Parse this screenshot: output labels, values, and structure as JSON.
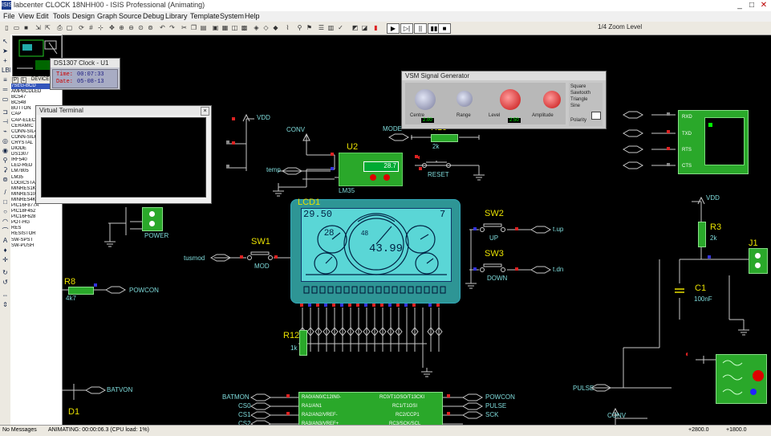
{
  "window": {
    "title": "labcenter CLOCK 18NHH00 - ISIS Professional (Animating)",
    "minimize": "_",
    "maximize": "□",
    "close": "✕"
  },
  "menu": [
    "File",
    "View",
    "Edit",
    "Tools",
    "Design",
    "Graph",
    "Source",
    "Debug",
    "Library",
    "Template",
    "System",
    "Help"
  ],
  "toolbar": {
    "zoom_text": "1/4 Zoom Level"
  },
  "devices": {
    "tabs": [
      "P",
      "L",
      "DEVICES"
    ],
    "items": [
      "7SEG-BCD",
      "AMPBCDLED",
      "BC547",
      "BC548",
      "BUTTON",
      "CAP",
      "CAP-ELEC",
      "CERAMIC",
      "CONN-SIL4",
      "CONN-SIL6",
      "CRYSTAL",
      "DIODE",
      "DS1307",
      "IRF540",
      "LED-RED",
      "LM7805",
      "LM35",
      "LOGICSTATE",
      "MINRES1K",
      "MINRES10K",
      "MINRES4K7",
      "PIC16F877A",
      "PIC18F452",
      "PIC16F628",
      "POT-HG",
      "RES",
      "RESISTOR",
      "SW-SPST",
      "SW-PUSH"
    ],
    "selected_index": 0
  },
  "clock_window": {
    "title": "DS1307 Clock - U1",
    "time_label": "Time:",
    "time_value": "00:07:33",
    "date_label": "Date:",
    "date_value": "05-08-13"
  },
  "terminal_window": {
    "title": "Virtual Terminal"
  },
  "signal_window": {
    "title": "VSM Signal Generator",
    "knob_labels": [
      "Centre",
      "Range",
      "Level",
      "Amplitude"
    ],
    "display_values": [
      "2.00",
      "1.0",
      "2.50",
      "1.0"
    ],
    "waveforms": [
      "Square",
      "Sawtooth",
      "Triangle",
      "Sine"
    ],
    "polarity_label": "Polarity"
  },
  "schematic": {
    "lcd_ref": "LCD1",
    "lcd_top_left": "29.50",
    "lcd_top_right": "7",
    "lcd_left_gauge": "28",
    "lcd_center_value": "43.99",
    "lcd_center_small": "48",
    "u2_ref": "U2",
    "u2_value": "28.7",
    "u2_part": "LM35",
    "sw1": "SW1",
    "sw1_sub": "MOD",
    "sw2": "SW2",
    "sw2_sub": "UP",
    "sw3": "SW3",
    "sw3_sub": "DOWN",
    "r8": "R8",
    "r8_val": "4k7",
    "r10": "R10",
    "r10_val": "2k",
    "r12": "R12",
    "r12_val": "1k",
    "r3": "R3",
    "r3_val": "2k",
    "j1": "J1",
    "c1": "C1",
    "c1_val": "100nF",
    "d1": "D1",
    "power_label": "POWER",
    "vdd": "VDD",
    "vdd2": "VDD",
    "conv": "CONV",
    "conv2": "CONV",
    "mode_net": "MODE",
    "temp_net": "temp",
    "tusmod_net": "tusmod",
    "reset_net": "RESET",
    "up_net": "t.up",
    "down_net": "t.dn",
    "powcon": "POWCON",
    "batvon": "BATVON",
    "pulse": "PULSE",
    "pulse2": "PULSE",
    "powcon2": "POWCON",
    "rx_labels": [
      "RXD",
      "TXD",
      "RTS",
      "CTS"
    ],
    "pic_left": [
      "RA0/AN0/C12IN0-",
      "RA1/AN1",
      "RA2/AN2/VREF-",
      "RA3/AN3/VREF+"
    ],
    "pic_right": [
      "RC0/T1OSO/T13CKI",
      "RC1/T1OSI",
      "RC2/CCP1",
      "RC3/SCK/SCL"
    ],
    "pic_left_nets": [
      "BATMON",
      "CS0",
      "CS1",
      "CS2"
    ],
    "pic_right_nets": [
      "POWCON",
      "PULSE",
      "SCK"
    ]
  },
  "status": {
    "left": "No Messages",
    "messages": "ANIMATING: 00:00:06.3 (CPU load: 1%)",
    "coords": "+2800.0",
    "coords2": "+1800.0"
  }
}
